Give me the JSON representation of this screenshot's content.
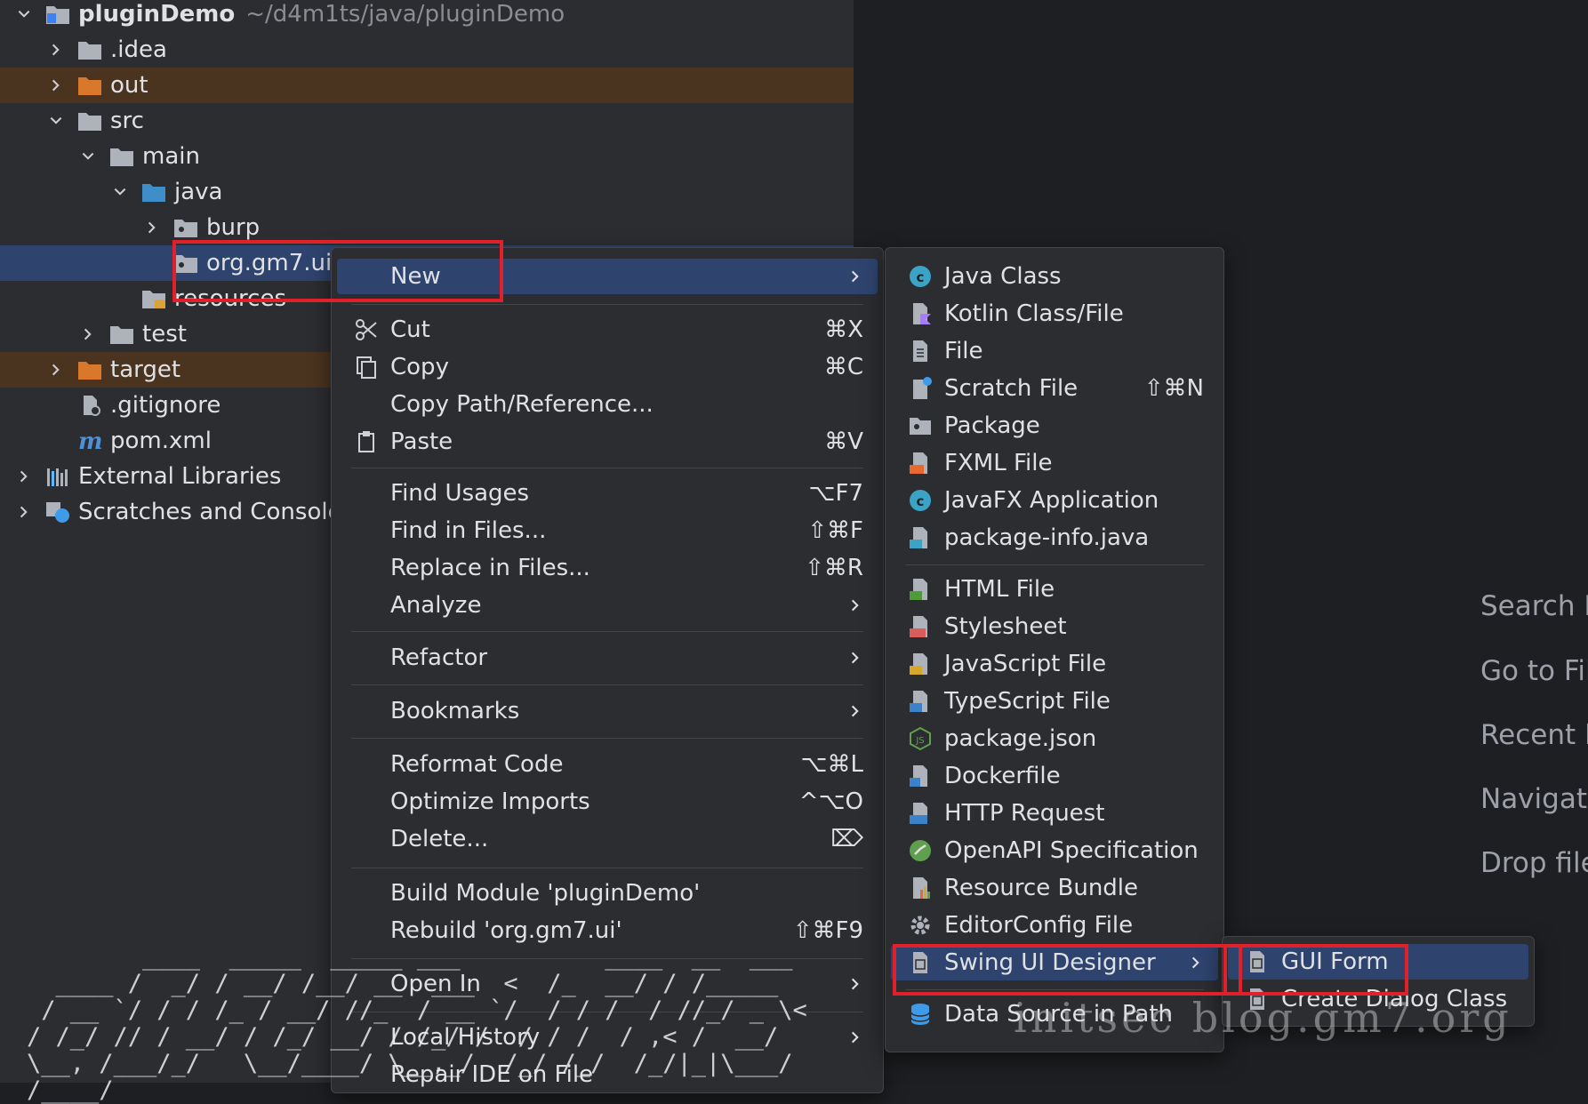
{
  "tree": {
    "root": {
      "label": "pluginDemo",
      "path": "~/d4m1ts/java/pluginDemo"
    },
    "idea": ".idea",
    "out": "out",
    "src": "src",
    "main": "main",
    "java": "java",
    "burp": "burp",
    "pkg": "org.gm7.ui",
    "resources": "resources",
    "test": "test",
    "target": "target",
    "gitignore": ".gitignore",
    "pom": "pom.xml",
    "external": "External Libraries",
    "scratches": "Scratches and Consoles"
  },
  "context_menu": {
    "new": "New",
    "cut": {
      "label": "Cut",
      "shortcut": "⌘X"
    },
    "copy": {
      "label": "Copy",
      "shortcut": "⌘C"
    },
    "copy_path": "Copy Path/Reference...",
    "paste": {
      "label": "Paste",
      "shortcut": "⌘V"
    },
    "find_usages": {
      "label": "Find Usages",
      "shortcut": "⌥F7"
    },
    "find_in_files": {
      "label": "Find in Files...",
      "shortcut": "⇧⌘F"
    },
    "replace_in_files": {
      "label": "Replace in Files...",
      "shortcut": "⇧⌘R"
    },
    "analyze": "Analyze",
    "refactor": "Refactor",
    "bookmarks": "Bookmarks",
    "reformat": {
      "label": "Reformat Code",
      "shortcut": "⌥⌘L"
    },
    "optimize": {
      "label": "Optimize Imports",
      "shortcut": "^⌥O"
    },
    "delete": {
      "label": "Delete...",
      "shortcut": "⌦"
    },
    "build_module": "Build Module 'pluginDemo'",
    "rebuild": {
      "label": "Rebuild 'org.gm7.ui'",
      "shortcut": "⇧⌘F9"
    },
    "open_in": "Open In",
    "local_history": "Local History",
    "repair": "Repair IDE on File"
  },
  "new_menu": {
    "java_class": "Java Class",
    "kotlin": "Kotlin Class/File",
    "file": "File",
    "scratch": {
      "label": "Scratch File",
      "shortcut": "⇧⌘N"
    },
    "package": "Package",
    "fxml": "FXML File",
    "javafx": "JavaFX Application",
    "package_info": "package-info.java",
    "html": "HTML File",
    "stylesheet": "Stylesheet",
    "javascript": "JavaScript File",
    "typescript": "TypeScript File",
    "package_json": "package.json",
    "dockerfile": "Dockerfile",
    "http": "HTTP Request",
    "openapi": "OpenAPI Specification",
    "resource_bundle": "Resource Bundle",
    "editorconfig": "EditorConfig File",
    "swing": "Swing UI Designer",
    "datasource": "Data Source in Path"
  },
  "swing_menu": {
    "gui_form": "GUI Form",
    "dialog": "Create Dialog Class"
  },
  "editor_hints": [
    "Search E",
    "Go to Fil",
    "Recent F",
    "Navigati",
    "Drop file"
  ],
  "watermark": "initsec blog.gm7.org",
  "ascii_art": "        ____  _____  _____ ___          ____  __  ___\n  ____ /  _/ / __/ /__/ __  ___  <  /_  __/ / /_____\n / __ `/ / / /_ / __/ //_  / __ `/  / / /  / //_/ _ \\<\n/ /_/ // / __/ / /_/ __/ / /_/ /  / / /  / ,< /  __/\n\\__, /___/_/   \\__/____/ \\__,_/  /_/ /_/  /_/|_|\\___/\n/____/",
  "colors": {
    "accent_red": "#e0202a",
    "selection": "#2e436e",
    "excluded": "#4a3420",
    "menu_bg": "#2b2d30"
  }
}
